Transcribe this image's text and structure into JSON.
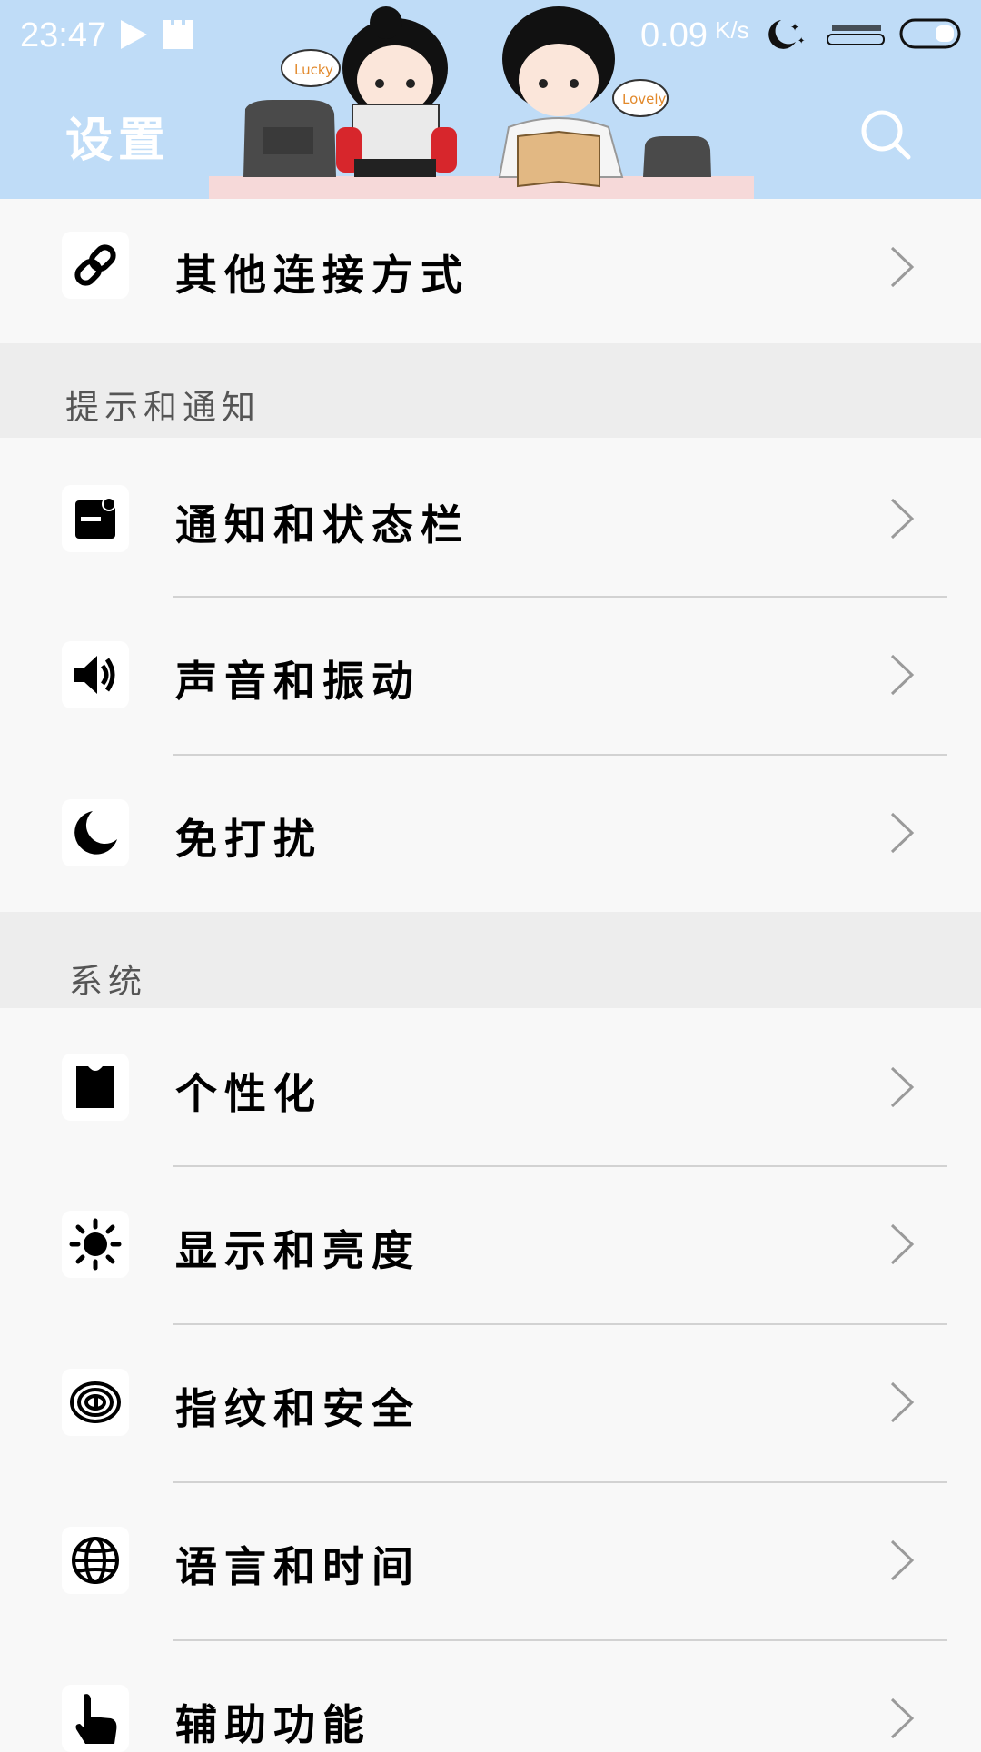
{
  "status_bar": {
    "time": "23:47",
    "net_speed": "0.09",
    "net_unit": "K/s",
    "icons": [
      "play-icon",
      "sd-card-icon",
      "moon-stars-icon",
      "signal-icon",
      "battery-icon"
    ]
  },
  "header": {
    "title": "设置",
    "search_icon": "search-icon",
    "background_color": "#bfdcf7",
    "illustration_labels": [
      "Lucky",
      "Lovely"
    ]
  },
  "rows": {
    "other_connection": {
      "label": "其他连接方式",
      "icon": "link-icon"
    },
    "notifications": {
      "label": "通知和状态栏",
      "icon": "notification-icon"
    },
    "sound": {
      "label": "声音和振动",
      "icon": "speaker-icon"
    },
    "dnd": {
      "label": "免打扰",
      "icon": "moon-icon"
    },
    "personalize": {
      "label": "个性化",
      "icon": "shirt-icon"
    },
    "display": {
      "label": "显示和亮度",
      "icon": "sun-icon"
    },
    "fingerprint": {
      "label": "指纹和安全",
      "icon": "fingerprint-icon"
    },
    "language": {
      "label": "语言和时间",
      "icon": "globe-icon"
    },
    "accessibility": {
      "label": "辅助功能",
      "icon": "hand-icon"
    }
  },
  "sections": {
    "notify": "提示和通知",
    "system": "系统"
  }
}
